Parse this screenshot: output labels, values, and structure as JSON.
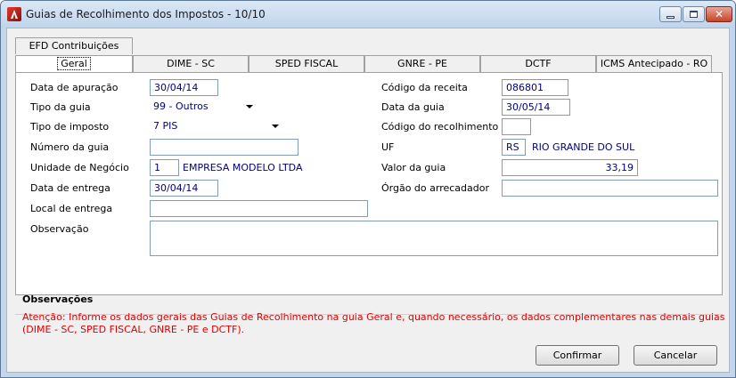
{
  "window": {
    "title": "Guias de Recolhimento dos Impostos - 10/10",
    "icon": "app-logo-icon",
    "controls": {
      "minimize": "minimize-icon",
      "maximize": "maximize-icon",
      "close": "close-icon"
    }
  },
  "tabs": {
    "row_top": [
      {
        "label": "EFD Contribuições"
      }
    ],
    "row_bottom": [
      {
        "label": "Geral",
        "active": true
      },
      {
        "label": "DIME - SC"
      },
      {
        "label": "SPED FISCAL"
      },
      {
        "label": "GNRE - PE"
      },
      {
        "label": "DCTF"
      },
      {
        "label": "ICMS Antecipado - RO"
      }
    ]
  },
  "form": {
    "data_apuracao": {
      "label": "Data de apuração",
      "value": "30/04/14"
    },
    "tipo_guia": {
      "label": "Tipo da guia",
      "value": "99 - Outros"
    },
    "tipo_imposto": {
      "label": "Tipo de imposto",
      "value": "7 PIS"
    },
    "numero_guia": {
      "label": "Número da guia",
      "value": ""
    },
    "unidade_negocio": {
      "label": "Unidade de Negócio",
      "code": "1",
      "name": "EMPRESA MODELO LTDA"
    },
    "data_entrega": {
      "label": "Data de entrega",
      "value": "30/04/14"
    },
    "local_entrega": {
      "label": "Local de entrega",
      "value": ""
    },
    "observacao": {
      "label": "Observação",
      "value": ""
    },
    "codigo_receita": {
      "label": "Código da receita",
      "value": "086801"
    },
    "data_guia": {
      "label": "Data da guia",
      "value": "30/05/14"
    },
    "codigo_recolhimento": {
      "label": "Código do recolhimento",
      "value": ""
    },
    "uf": {
      "label": "UF",
      "code": "RS",
      "name": "RIO GRANDE DO SUL"
    },
    "valor_guia": {
      "label": "Valor da guia",
      "value": "33,19"
    },
    "orgao_arrecadador": {
      "label": "Órgão do arrecadador",
      "value": ""
    }
  },
  "observacoes": {
    "title": "Observações",
    "line1": "Atenção: Informe os dados gerais das Guias de Recolhimento na guia Geral e, quando necessário, os dados complementares nas demais guias",
    "line2": "(DIME - SC, SPED FISCAL, GNRE - PE e DCTF)."
  },
  "buttons": {
    "confirm": "Confirmar",
    "cancel": "Cancelar"
  },
  "colors": {
    "value_text": "#00007f",
    "warning_text": "#e00000",
    "titlebar": "#c4d7ea"
  }
}
